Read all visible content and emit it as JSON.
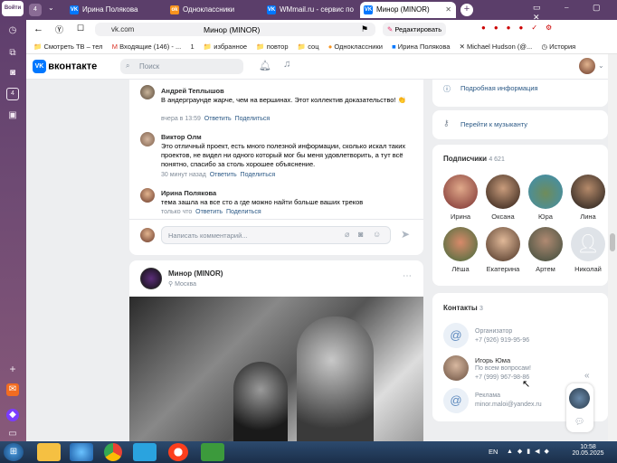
{
  "browser": {
    "yandex_badge": "Войти",
    "tab_count": "4",
    "tabs": [
      {
        "label": "Ирина Полякова"
      },
      {
        "label": "Одноклассники"
      },
      {
        "label": "WMmail.ru - сервис по"
      },
      {
        "label": "Минор (MINOR)"
      }
    ],
    "url": "vk.com",
    "page_title": "Минор (MINOR)",
    "edit_label": "Редактировать",
    "bookmarks": [
      "Смотреть ТВ – тел",
      "Входящие (146) - ...",
      "1",
      "избранное",
      "повтор",
      "соц",
      "Одноклассники",
      "Ирина Полякова",
      "Michael Hudson (@...",
      "История"
    ]
  },
  "vk": {
    "logo": "вконтакте",
    "search_placeholder": "Поиск"
  },
  "comments": [
    {
      "author": "Андрей Теплышов",
      "text": "В андерграунде жарче, чем на вершинах. Этот коллектив доказательство! 👏",
      "time": "вчера в 13:59",
      "reply": "Ответить",
      "share": "Поделиться"
    },
    {
      "author": "Виктор Олм",
      "text": "Это отличный проект, есть много полезной информации, сколько искал таких проектов, не видел ни одного который мог бы меня удовлетворить, а тут всё понятно, спасибо за столь хорошее объяснение.",
      "time": "30 минут назад",
      "reply": "Ответить",
      "share": "Поделиться"
    },
    {
      "author": "Ирина Полякова",
      "text": "тема зашла на все сто а где можно найти больше ваших треков",
      "time": "только что",
      "reply": "Ответить",
      "share": "Поделиться"
    }
  ],
  "comment_input": {
    "placeholder": "Написать комментарий..."
  },
  "post": {
    "author": "Минор (MINOR)",
    "location": "Москва"
  },
  "right": {
    "more_info": "Подробная информация",
    "go_musician": "Перейти к музыканту",
    "subscribers_title": "Подписчики",
    "subscribers_count": "4 621",
    "subscribers": [
      "Ирина",
      "Оксана",
      "Юра",
      "Лина",
      "Лёша",
      "Екатерина",
      "Артем",
      "Николай"
    ],
    "contacts_title": "Контакты",
    "contacts_count": "3",
    "contacts": [
      {
        "name": "Организатор",
        "detail": "+7 (926) 919-95-96",
        "extra": ""
      },
      {
        "name": "Игорь Юма",
        "detail": "По всем вопросам!",
        "extra": "+7 (999) 967-98-86"
      },
      {
        "name": "Реклама",
        "detail": "minor.maloi@yandex.ru",
        "extra": ""
      }
    ]
  },
  "taskbar": {
    "lang": "EN",
    "time": "10:58",
    "date": "20.05.2025"
  },
  "colors": {
    "vk_blue": "#0077ff",
    "link": "#2a5885",
    "browser_purple": "#5b3e6a"
  }
}
